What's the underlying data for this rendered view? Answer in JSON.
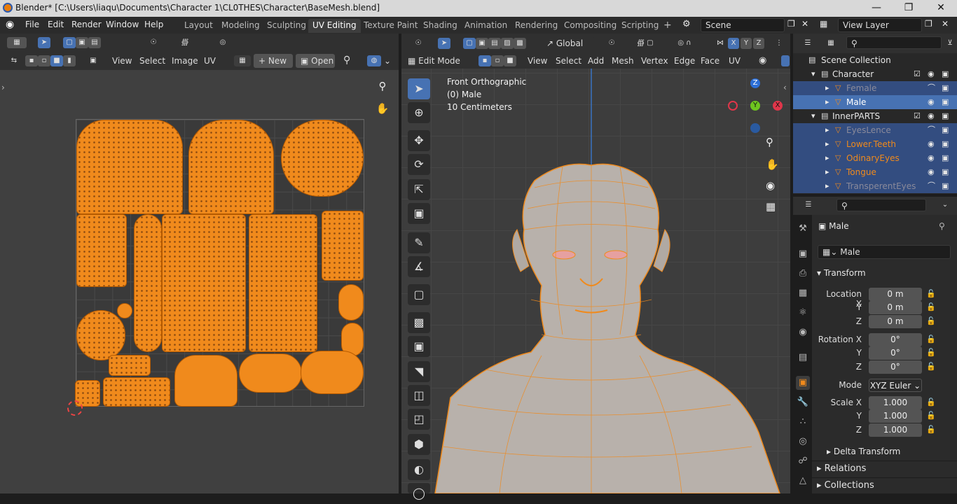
{
  "window": {
    "title": "Blender* [C:\\Users\\liaqu\\Documents\\Character 1\\CL0THES\\Character\\BaseMesh.blend]",
    "minimize_icon": "minimize-icon",
    "maximize_icon": "maximize-icon",
    "close_icon": "close-icon"
  },
  "menubar": {
    "items": [
      "File",
      "Edit",
      "Render",
      "Window",
      "Help"
    ]
  },
  "workspaces": [
    {
      "label": "Layout",
      "active": false
    },
    {
      "label": "Modeling",
      "active": false
    },
    {
      "label": "Sculpting",
      "active": false
    },
    {
      "label": "UV Editing",
      "active": true
    },
    {
      "label": "Texture Paint",
      "active": false
    },
    {
      "label": "Shading",
      "active": false
    },
    {
      "label": "Animation",
      "active": false
    },
    {
      "label": "Rendering",
      "active": false
    },
    {
      "label": "Compositing",
      "active": false
    },
    {
      "label": "Scripting",
      "active": false
    }
  ],
  "scene": {
    "value": "Scene"
  },
  "view_layer": {
    "value": "View Layer"
  },
  "uv_editor": {
    "menus": [
      "View",
      "Select",
      "Image",
      "UV"
    ],
    "new_label": "New",
    "open_label": "Open"
  },
  "viewport": {
    "mode": "Edit Mode",
    "orientation": "Global",
    "menus": [
      "View",
      "Select",
      "Add",
      "Mesh",
      "Vertex",
      "Edge",
      "Face",
      "UV"
    ],
    "overlay_view": "Front Orthographic",
    "overlay_object": "(0) Male",
    "overlay_scale": "10 Centimeters",
    "gizmo": {
      "x": "X",
      "y": "Y",
      "z": "Z"
    },
    "axis_lock": [
      "X",
      "Y",
      "Z"
    ]
  },
  "outliner": {
    "root": "Scene Collection",
    "rows": [
      {
        "name": "Character",
        "kind": "collection",
        "indent": 1,
        "selected": false,
        "active": false
      },
      {
        "name": "Female",
        "kind": "object",
        "indent": 2,
        "selected": true,
        "active": false,
        "dim": true
      },
      {
        "name": "Male",
        "kind": "object",
        "indent": 2,
        "selected": true,
        "active": true,
        "dim": false
      },
      {
        "name": "InnerPARTS",
        "kind": "collection",
        "indent": 1,
        "selected": false,
        "active": false
      },
      {
        "name": "EyesLence",
        "kind": "object",
        "indent": 2,
        "selected": true,
        "active": false,
        "dim": true
      },
      {
        "name": "Lower.Teeth",
        "kind": "object",
        "indent": 2,
        "selected": true,
        "active": false,
        "dim": false
      },
      {
        "name": "OdinaryEyes",
        "kind": "object",
        "indent": 2,
        "selected": true,
        "active": false,
        "dim": false
      },
      {
        "name": "Tongue",
        "kind": "object",
        "indent": 2,
        "selected": true,
        "active": false,
        "dim": false
      },
      {
        "name": "TransperentEyes",
        "kind": "object",
        "indent": 2,
        "selected": true,
        "active": false,
        "dim": true
      }
    ]
  },
  "properties": {
    "object_name": "Male",
    "datablock_name": "Male",
    "transform_label": "Transform",
    "location_label": "Location X",
    "rotation_label": "Rotation X",
    "scale_label": "Scale X",
    "y_label": "Y",
    "z_label": "Z",
    "location": [
      "0 m",
      "0 m",
      "0 m"
    ],
    "rotation": [
      "0°",
      "0°",
      "0°"
    ],
    "mode_label": "Mode",
    "mode_value": "XYZ Euler",
    "scale": [
      "1.000",
      "1.000",
      "1.000"
    ],
    "delta_transform": "Delta Transform",
    "relations": "Relations",
    "collections": "Collections"
  },
  "colors": {
    "accent": "#4772b3",
    "uv_orange": "#f08a1c",
    "selection_row": "#334d80"
  }
}
